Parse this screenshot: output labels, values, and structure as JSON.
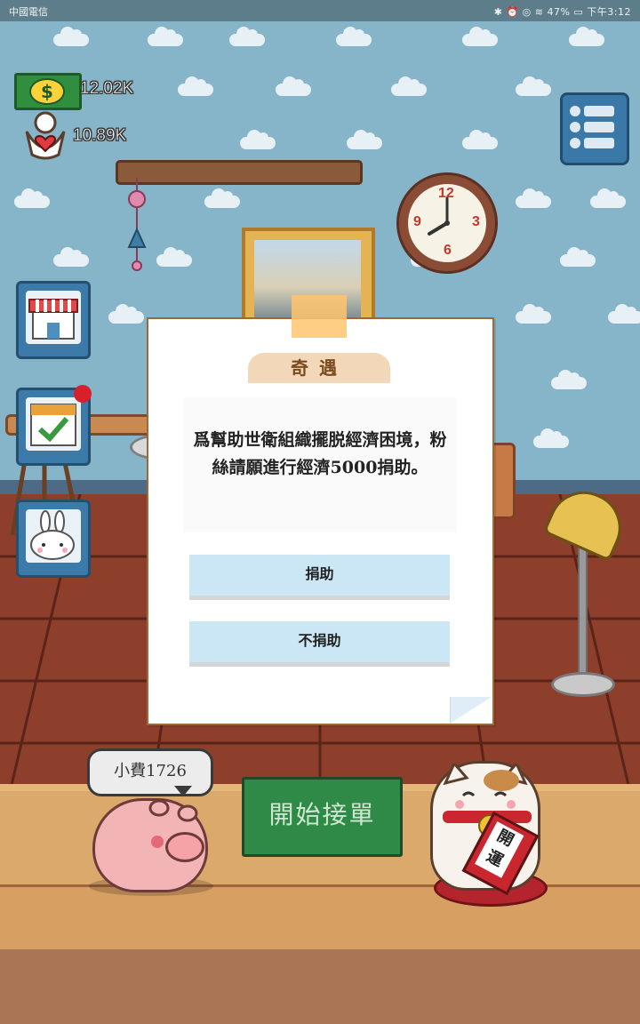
{
  "status_bar": {
    "carrier": "中國電信",
    "right": "✱ ⏰ ◎ ≋ 47% ▭ 下午3:12"
  },
  "hud": {
    "money": "12.02K",
    "fans": "10.89K",
    "money_symbol": "$"
  },
  "clock": {
    "n12": "12",
    "n3": "3",
    "n6": "6",
    "n9": "9"
  },
  "dialog": {
    "title": "奇遇",
    "message": "爲幫助世衛組織擺脱經濟困境，粉絲請願進行經濟5000捐助。",
    "options": [
      "捐助",
      "不捐助"
    ]
  },
  "tip_bubble": "小費1726",
  "start_button": "開始接單",
  "lucky_cat_sign": "開運",
  "colors": {
    "wall": "#86b4c8",
    "floor": "#8e3f2c",
    "option_button": "#cbe7f6",
    "start_button": "#2f8a47"
  }
}
